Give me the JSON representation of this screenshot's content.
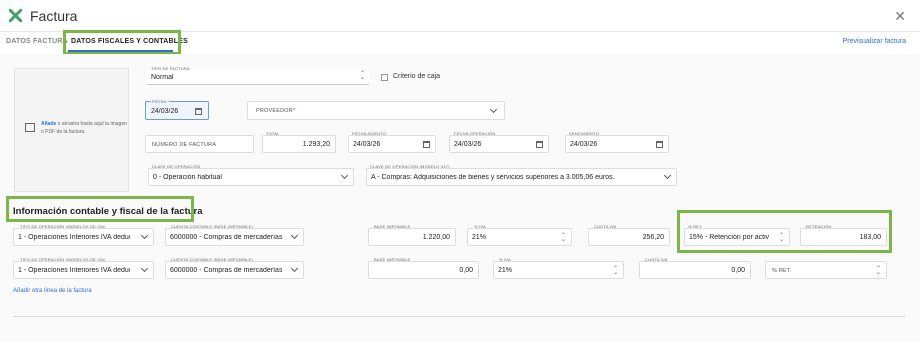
{
  "window": {
    "title": "Factura"
  },
  "tabs": [
    {
      "label": "DATOS FACTURA"
    },
    {
      "label": "DATOS FISCALES Y CONTABLES"
    }
  ],
  "preview_link": "Previsualizar factura",
  "dropzone": {
    "link": "Añade",
    "text": " o arrastra hasta aquí la imagen o PDF de la factura."
  },
  "invoice": {
    "tipo_label": "TIPO DE FACTURA",
    "tipo_value": "Normal",
    "criterio_label": "Criterio de caja",
    "fecha_label": "FECHA *",
    "fecha_value": "24/03/26",
    "proveedor_label": "PROVEEDOR",
    "proveedor_required": "*",
    "numero_placeholder": "NÚMERO DE FACTURA",
    "total_label": "TOTAL",
    "total_value": "1.293,20",
    "asiento_label": "FECHA ASIENTO",
    "asiento_value": "24/03/26",
    "operacion_label": "FECHA OPERACIÓN",
    "operacion_value": "24/03/26",
    "vencimiento_label": "VENCIMIENTO",
    "vencimiento_value": "24/03/26",
    "clave_label": "CLAVE DE OPERACIÓN",
    "clave_value": "0 - Operación habitual",
    "clave347_label": "CLAVE DE OPERACIÓN (MODELO 347)",
    "clave347_value": "A - Compras: Adquisiciones de bienes y servicios superiores a 3.005,06 euros."
  },
  "section_title": "Información contable y fiscal de la factura",
  "line_labels": {
    "tipo_op": "TIPO DE OPERACIÓN (MODELOS DE IVA)",
    "cuenta": "CUENTA CONTABLE (BASE IMPONIBLE)",
    "base": "BASE IMPONIBLE",
    "iva_pct": "% IVA",
    "cuota": "CUOTA IVA",
    "ret_pct": "% RET.",
    "retencion": "RETENCIÓN"
  },
  "lines": [
    {
      "tipo_op": "1 - Operaciones Interiores IVA deduc",
      "cuenta": "6000000 - Compras de mercaderías",
      "base": "1.220,00",
      "iva_pct": "21%",
      "cuota": "256,20",
      "ret_pct": "15% - Retención por activ",
      "retencion": "183,00"
    },
    {
      "tipo_op": "1 - Operaciones Interiores IVA deduc",
      "cuenta": "6000000 - Compras de mercaderías",
      "base": "0,00",
      "iva_pct": "21%",
      "cuota": "0,00",
      "ret_pct": "% RET."
    }
  ],
  "add_line": "Añadir otra línea de la factura",
  "colors": {
    "accent": "#2a6fdb",
    "highlight": "#7ab648",
    "logo": "#3fa36b"
  }
}
